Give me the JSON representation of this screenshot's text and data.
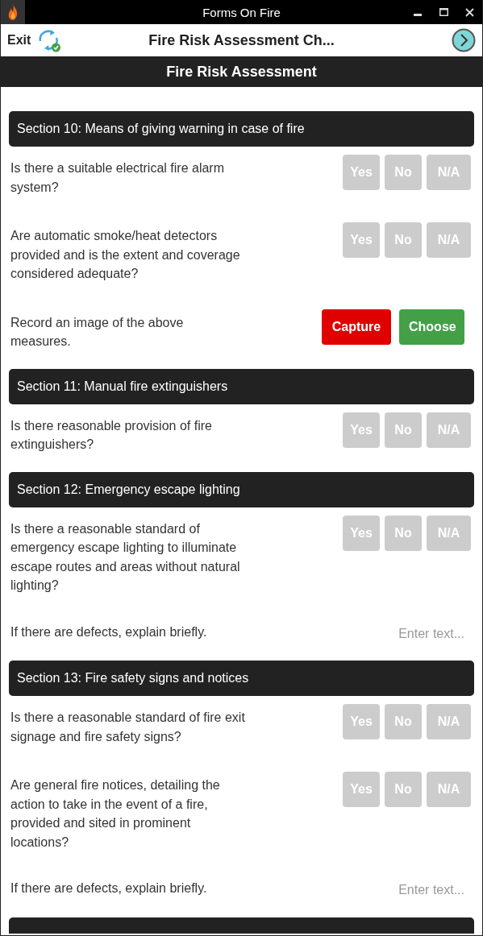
{
  "window": {
    "title": "Forms On Fire"
  },
  "header": {
    "exit": "Exit",
    "title": "Fire Risk Assessment Ch..."
  },
  "form_title": "Fire Risk Assessment",
  "sections": [
    {
      "title": "Section 10: Means of giving warning in case of fire",
      "items": [
        {
          "kind": "choice",
          "question": "Is there a suitable electrical fire alarm system?",
          "options": [
            {
              "label": "Yes",
              "selected": false
            },
            {
              "label": "No",
              "selected": false
            },
            {
              "label": "N/A",
              "selected": false
            }
          ]
        },
        {
          "kind": "choice",
          "question": "Are automatic smoke/heat detectors provided and is the extent and coverage considered adequate?",
          "options": [
            {
              "label": "Yes",
              "selected": false
            },
            {
              "label": "No",
              "selected": false
            },
            {
              "label": "N/A",
              "selected": false
            }
          ]
        },
        {
          "kind": "image",
          "question": "Record an image of the above measures.",
          "capture": "Capture",
          "choose": "Choose"
        }
      ]
    },
    {
      "title": "Section 11: Manual fire extinguishers",
      "items": [
        {
          "kind": "choice",
          "question": "Is there reasonable provision of fire extinguishers?",
          "options": [
            {
              "label": "Yes",
              "selected": false
            },
            {
              "label": "No",
              "selected": false
            },
            {
              "label": "N/A",
              "selected": false
            }
          ]
        }
      ]
    },
    {
      "title": "Section 12: Emergency escape lighting",
      "items": [
        {
          "kind": "choice",
          "question": "Is there a reasonable standard of emergency escape lighting to illuminate escape routes and areas without natural lighting?",
          "options": [
            {
              "label": "Yes",
              "selected": false
            },
            {
              "label": "No",
              "selected": false
            },
            {
              "label": "N/A",
              "selected": false
            }
          ]
        },
        {
          "kind": "text",
          "question": "If there are defects,  explain briefly.",
          "placeholder": "Enter text..."
        }
      ]
    },
    {
      "title": "Section 13: Fire safety signs and notices",
      "items": [
        {
          "kind": "choice",
          "question": "Is there a reasonable standard of fire exit signage and fire safety signs?",
          "options": [
            {
              "label": "Yes",
              "selected": false
            },
            {
              "label": "No",
              "selected": false
            },
            {
              "label": "N/A",
              "selected": false
            }
          ]
        },
        {
          "kind": "choice",
          "question": "Are general fire notices, detailing the action to take in the event of a fire, provided and sited in prominent locations?",
          "options": [
            {
              "label": "Yes",
              "selected": false
            },
            {
              "label": "No",
              "selected": false
            },
            {
              "label": "N/A",
              "selected": false
            }
          ]
        },
        {
          "kind": "text",
          "question": "If there are defects,  explain briefly.",
          "placeholder": "Enter text..."
        }
      ]
    }
  ]
}
